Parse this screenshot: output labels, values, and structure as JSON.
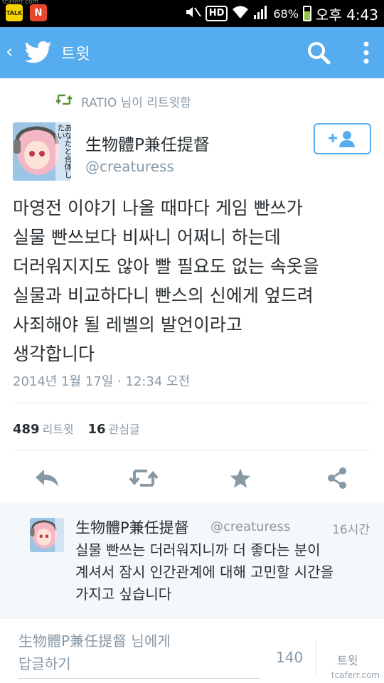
{
  "watermarks": {
    "top_left": "tcaferr.com",
    "bottom_right": "tcaferr.com"
  },
  "status_bar": {
    "app_icons": [
      {
        "label": "TALK",
        "color": "#f5d300"
      },
      {
        "label": "N",
        "color": "#e8472b"
      }
    ],
    "hd_label": "HD",
    "battery_percent_text": "68%",
    "battery_level": 0.68,
    "time": "오후 4:43"
  },
  "app_bar": {
    "back": "‹",
    "title": "트윗",
    "brand_color": "#55acee"
  },
  "tweet": {
    "retweeted_by": "RATIO 님이 리트윗함",
    "avatar_caption": "あなたと合体したい",
    "name": "生物體P兼任提督",
    "handle": "@creaturess",
    "text": "마영전 이야기 나올 때마다 게임 빤쓰가\n실물 빤쓰보다 비싸니 어쩌니 하는데\n더러워지지도 않아 빨 필요도 없는 속옷을\n실물과 비교하다니 빤스의 신에게 엎드려\n사죄해야 될 레벨의 발언이라고\n생각합니다",
    "timestamp": "2014년 1월 17일 · 12:34 오전",
    "retweet_count": "489",
    "retweet_label": "리트윗",
    "favorite_count": "16",
    "favorite_label": "관심글"
  },
  "reply": {
    "name": "生物體P兼任提督",
    "handle": "@creaturess",
    "time": "16시간",
    "text": "실물 빤쓰는 더러워지니까 더 좋다는 분이\n계셔서 잠시 인간관계에 대해 고민할 시간을\n가지고 싶습니다"
  },
  "composer": {
    "placeholder": "生物體P兼任提督 님에게\n답글하기",
    "char_count": "140",
    "tweet_button": "트윗"
  }
}
